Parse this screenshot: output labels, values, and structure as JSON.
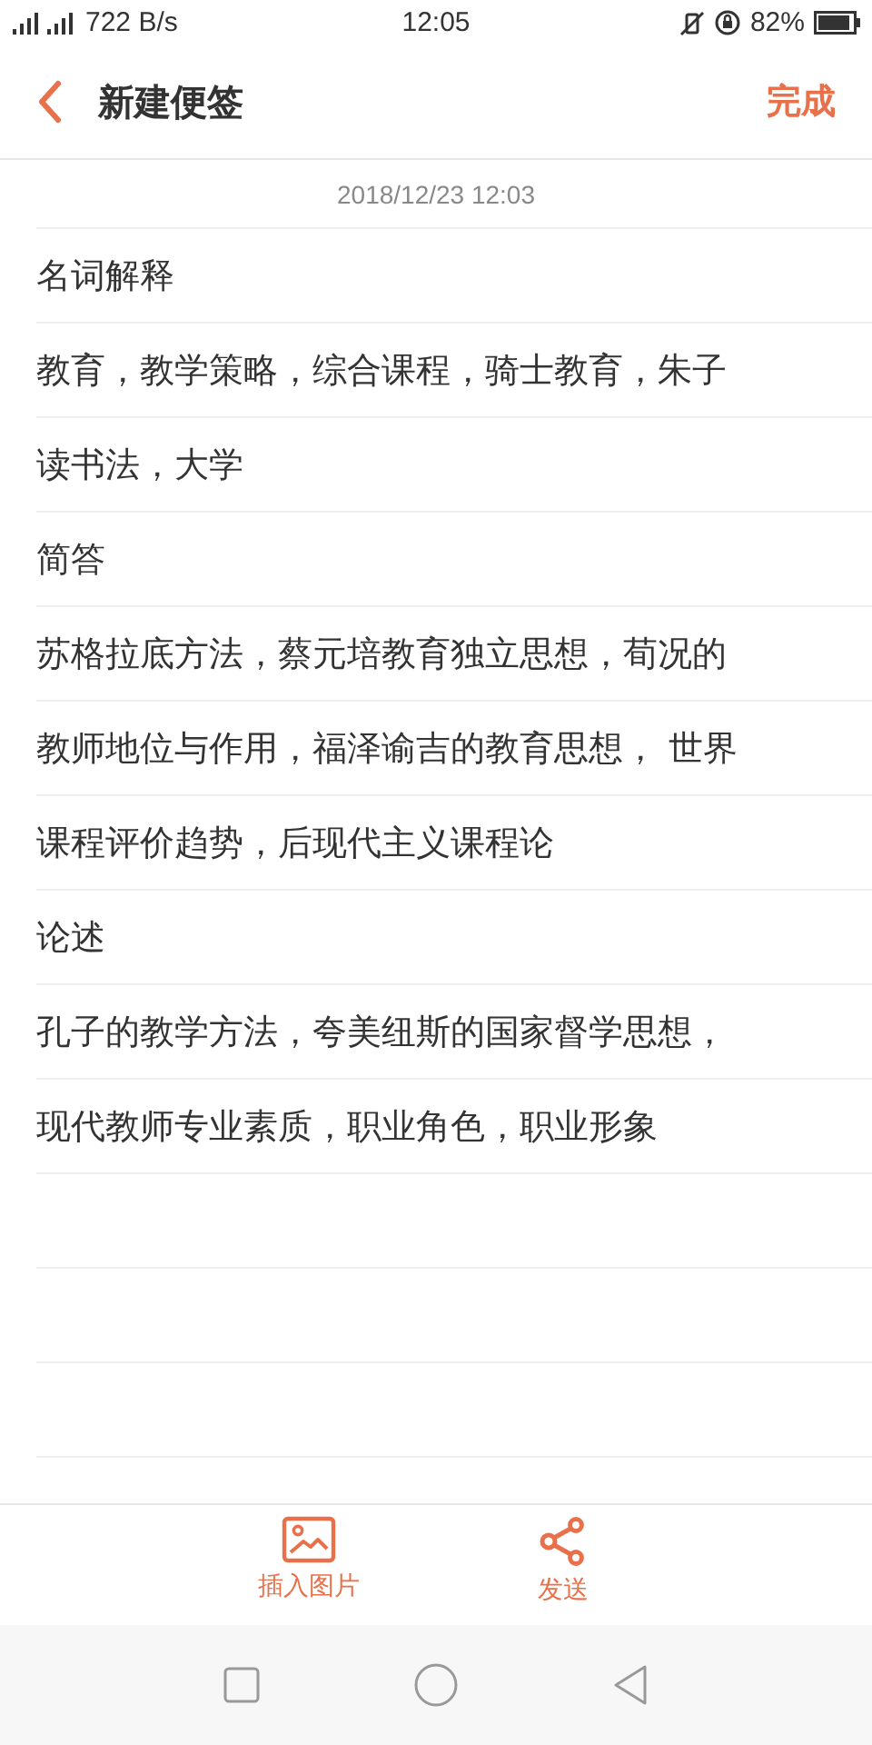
{
  "status_bar": {
    "network_speed": "722 B/s",
    "time": "12:05",
    "battery": "82%"
  },
  "header": {
    "title": "新建便签",
    "done_button": "完成"
  },
  "note": {
    "timestamp": "2018/12/23 12:03",
    "lines": [
      "名词解释",
      "教育，教学策略，综合课程，骑士教育，朱子",
      "读书法，大学",
      "简答",
      "苏格拉底方法，蔡元培教育独立思想，荀况的",
      "教师地位与作用，福泽谕吉的教育思想， 世界",
      "课程评价趋势，后现代主义课程论",
      "论述",
      "孔子的教学方法，夸美纽斯的国家督学思想，",
      "现代教师专业素质，职业角色，职业形象"
    ]
  },
  "toolbar": [
    {
      "kind": "image",
      "label": "插入图片"
    },
    {
      "kind": "share",
      "label": "发送"
    }
  ]
}
